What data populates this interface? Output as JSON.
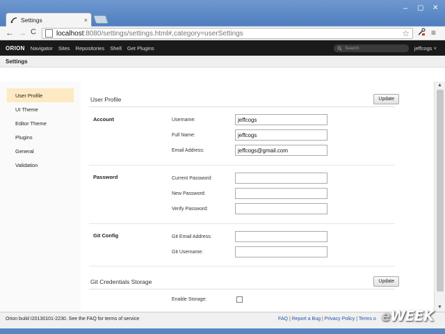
{
  "browser": {
    "tab_title": "Settings",
    "tab_close": "×",
    "window_controls": {
      "minimize": "–",
      "maximize": "▢",
      "close": "✕"
    },
    "nav": {
      "back": "←",
      "forward": "→",
      "reload": "C"
    },
    "url_host": "localhost",
    "url_rest": ":8080/settings/settings.html#,category=userSettings",
    "star": "☆",
    "menu": "≡"
  },
  "orion": {
    "logo": "ORION",
    "nav": [
      "Navigator",
      "Sites",
      "Repositories",
      "Shell",
      "Get Plugins"
    ],
    "search_placeholder": "Search",
    "user": "jeffcogs ˅"
  },
  "page": {
    "title": "Settings"
  },
  "sidebar": {
    "items": [
      {
        "label": "User Profile",
        "active": true
      },
      {
        "label": "UI Theme"
      },
      {
        "label": "Editor Theme"
      },
      {
        "label": "Plugins"
      },
      {
        "label": "General"
      },
      {
        "label": "Validation"
      }
    ]
  },
  "user_profile": {
    "title": "User Profile",
    "update_label": "Update",
    "account": {
      "title": "Account",
      "username_label": "Username:",
      "username_value": "jeffcogs",
      "fullname_label": "Full Name:",
      "fullname_value": "jeffcogs",
      "email_label": "Email Address:",
      "email_value": "jeffcogs@gmail.com"
    },
    "password": {
      "title": "Password",
      "current_label": "Current Password:",
      "new_label": "New Password:",
      "verify_label": "Verify Password:"
    },
    "git": {
      "title": "Git Config",
      "email_label": "Git Email Address:",
      "username_label": "Git Username:"
    }
  },
  "git_credentials": {
    "title": "Git Credentials Storage",
    "update_label": "Update",
    "enable_label": "Enable Storage:"
  },
  "footer": {
    "build": "Orion build I20130101-2230. See the FAQ for terms of service",
    "links": [
      "FAQ",
      "Report a Bug",
      "Privacy Policy",
      "Terms o"
    ],
    "separator": "|"
  },
  "watermark": {
    "prefix": "e",
    "rest": "WEEK"
  }
}
